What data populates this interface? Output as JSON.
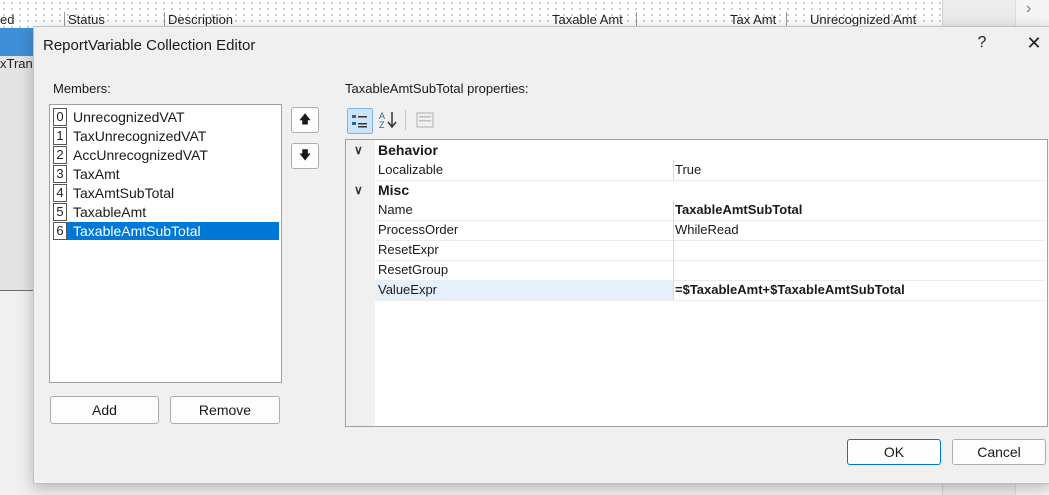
{
  "background": {
    "headers": [
      {
        "label": "ed"
      },
      {
        "label": "Status"
      },
      {
        "label": "Description"
      },
      {
        "label": "Taxable Amt"
      },
      {
        "label": "Tax Amt"
      },
      {
        "label": "Unrecognized Amt"
      }
    ],
    "left_text": "xTran",
    "scroll_arrow": "›"
  },
  "dialog": {
    "title": "ReportVariable Collection Editor",
    "help": "?",
    "close": "✕",
    "members_label": "Members:",
    "members": [
      {
        "index": "0",
        "name": "UnrecognizedVAT",
        "selected": false
      },
      {
        "index": "1",
        "name": "TaxUnrecognizedVAT",
        "selected": false
      },
      {
        "index": "2",
        "name": "AccUnrecognizedVAT",
        "selected": false
      },
      {
        "index": "3",
        "name": "TaxAmt",
        "selected": false
      },
      {
        "index": "4",
        "name": "TaxAmtSubTotal",
        "selected": false
      },
      {
        "index": "5",
        "name": "TaxableAmt",
        "selected": false
      },
      {
        "index": "6",
        "name": "TaxableAmtSubTotal",
        "selected": true
      }
    ],
    "move_up": "🡅",
    "move_down": "🡇",
    "add_label": "Add",
    "remove_label": "Remove",
    "properties_label": "TaxableAmtSubTotal properties:",
    "toolbar": {
      "categorized_icon": "categorized-icon",
      "alphabetical_icon": "alphabetical-icon",
      "property_pages_icon": "property-pages-icon"
    },
    "property_grid": {
      "categories": [
        {
          "name": "Behavior",
          "properties": [
            {
              "name": "Localizable",
              "value": "True",
              "bold": false
            }
          ]
        },
        {
          "name": "Misc",
          "properties": [
            {
              "name": "Name",
              "value": "TaxableAmtSubTotal",
              "bold": true
            },
            {
              "name": "ProcessOrder",
              "value": "WhileRead",
              "bold": false
            },
            {
              "name": "ResetExpr",
              "value": "",
              "bold": false
            },
            {
              "name": "ResetGroup",
              "value": "",
              "bold": false
            },
            {
              "name": "ValueExpr",
              "value": "=$TaxableAmt+$TaxableAmtSubTotal",
              "bold": true
            }
          ]
        }
      ],
      "selected_property": "ValueExpr"
    },
    "ok_label": "OK",
    "cancel_label": "Cancel"
  },
  "colors": {
    "selection": "#0078d7",
    "accent": "#0078d7"
  }
}
